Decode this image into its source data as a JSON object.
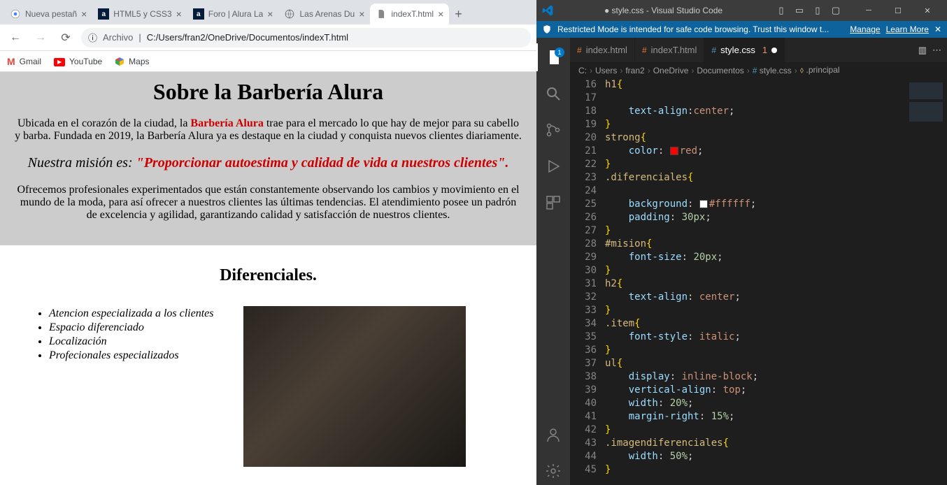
{
  "chrome": {
    "tabs": [
      {
        "title": "Nueva pestañ",
        "favType": "chrome"
      },
      {
        "title": "HTML5 y CSS3",
        "favType": "alura"
      },
      {
        "title": "Foro | Alura La",
        "favType": "alura"
      },
      {
        "title": "Las Arenas Du",
        "favType": "globe"
      },
      {
        "title": "indexT.html",
        "favType": "file",
        "active": true
      }
    ],
    "url_proto": "Archivo",
    "url_path": "C:/Users/fran2/OneDrive/Documentos/indexT.html",
    "bookmarks": [
      {
        "label": "Gmail",
        "icon": "M"
      },
      {
        "label": "YouTube",
        "icon": "▶"
      },
      {
        "label": "Maps",
        "icon": "📍"
      }
    ]
  },
  "page": {
    "h1": "Sobre la Barbería Alura",
    "p1_a": "Ubicada en el corazón de la ciudad, la ",
    "p1_strong": "Barbería Alura",
    "p1_b": " trae para el mercado lo que hay de mejor para su cabello y barba. Fundada en 2019, la Barbería Alura ya es destaque en la ciudad y conquista nuevos clientes diariamente.",
    "mision_a": "Nuestra misión es: ",
    "mision_strong": "\"Proporcionar autoestima y calidad de vida a nuestros clientes\".",
    "p2": "Ofrecemos profesionales experimentados que están constantemente observando los cambios y movimiento en el mundo de la moda, para así ofrecer a nuestros clientes las últimas tendencias. El atendimiento posee un padrón de excelencia y agilidad, garantizando calidad y satisfacción de nuestros clientes.",
    "h2": "Diferenciales.",
    "items": [
      "Atencion especializada a los clientes",
      "Espacio diferenciado",
      "Localización",
      "Profecionales especializados"
    ]
  },
  "vscode": {
    "title": "● style.css - Visual Studio Code",
    "banner_icon_label": "shield",
    "banner_msg": "Restricted Mode is intended for safe code browsing. Trust this window t...",
    "banner_manage": "Manage",
    "banner_learn": "Learn More",
    "editor_tabs": [
      {
        "label": "index.html",
        "icon": "html"
      },
      {
        "label": "indexT.html",
        "icon": "html"
      },
      {
        "label": "style.css",
        "icon": "css",
        "active": true,
        "modified": true,
        "errors": "1"
      }
    ],
    "breadcrumb": [
      "C:",
      "Users",
      "fran2",
      "OneDrive",
      "Documentos",
      "style.css",
      ".principal"
    ],
    "code_start": 16,
    "code_lines": [
      {
        "n": 16,
        "t": [
          [
            "sel",
            "h1"
          ],
          [
            "brace",
            "{"
          ]
        ]
      },
      {
        "n": 17,
        "t": []
      },
      {
        "n": 18,
        "t": [
          [
            "ind",
            "    "
          ],
          [
            "prop",
            "text-align"
          ],
          [
            "punc",
            ":"
          ],
          [
            "val",
            "center"
          ],
          [
            "punc",
            ";"
          ]
        ]
      },
      {
        "n": 19,
        "t": [
          [
            "brace",
            "}"
          ]
        ]
      },
      {
        "n": 20,
        "t": [
          [
            "sel",
            "strong"
          ],
          [
            "brace",
            "{"
          ]
        ]
      },
      {
        "n": 21,
        "t": [
          [
            "ind",
            "    "
          ],
          [
            "prop",
            "color"
          ],
          [
            "punc",
            ": "
          ],
          [
            "color",
            "#ff0000"
          ],
          [
            "val",
            "red"
          ],
          [
            "punc",
            ";"
          ]
        ]
      },
      {
        "n": 22,
        "t": [
          [
            "brace",
            "}"
          ]
        ]
      },
      {
        "n": 23,
        "t": [
          [
            "sel",
            ".diferenciales"
          ],
          [
            "brace",
            "{"
          ]
        ]
      },
      {
        "n": 24,
        "t": []
      },
      {
        "n": 25,
        "t": [
          [
            "ind",
            "    "
          ],
          [
            "prop",
            "background"
          ],
          [
            "punc",
            ": "
          ],
          [
            "color",
            "#ffffff"
          ],
          [
            "val",
            "#ffffff"
          ],
          [
            "punc",
            ";"
          ]
        ]
      },
      {
        "n": 26,
        "t": [
          [
            "ind",
            "    "
          ],
          [
            "prop",
            "padding"
          ],
          [
            "punc",
            ": "
          ],
          [
            "num",
            "30px"
          ],
          [
            "punc",
            ";"
          ]
        ]
      },
      {
        "n": 27,
        "t": [
          [
            "brace",
            "}"
          ]
        ]
      },
      {
        "n": 28,
        "t": [
          [
            "sel",
            "#mision"
          ],
          [
            "brace",
            "{"
          ]
        ]
      },
      {
        "n": 29,
        "t": [
          [
            "ind",
            "    "
          ],
          [
            "prop",
            "font-size"
          ],
          [
            "punc",
            ": "
          ],
          [
            "num",
            "20px"
          ],
          [
            "punc",
            ";"
          ]
        ]
      },
      {
        "n": 30,
        "t": [
          [
            "brace",
            "}"
          ]
        ]
      },
      {
        "n": 31,
        "t": [
          [
            "sel",
            "h2"
          ],
          [
            "brace",
            "{"
          ]
        ]
      },
      {
        "n": 32,
        "t": [
          [
            "ind",
            "    "
          ],
          [
            "prop",
            "text-align"
          ],
          [
            "punc",
            ": "
          ],
          [
            "val",
            "center"
          ],
          [
            "punc",
            ";"
          ]
        ]
      },
      {
        "n": 33,
        "t": [
          [
            "brace",
            "}"
          ]
        ]
      },
      {
        "n": 34,
        "t": [
          [
            "sel",
            ".item"
          ],
          [
            "brace",
            "{"
          ]
        ]
      },
      {
        "n": 35,
        "t": [
          [
            "ind",
            "    "
          ],
          [
            "prop",
            "font-style"
          ],
          [
            "punc",
            ": "
          ],
          [
            "val",
            "italic"
          ],
          [
            "punc",
            ";"
          ]
        ]
      },
      {
        "n": 36,
        "t": [
          [
            "brace",
            "}"
          ]
        ]
      },
      {
        "n": 37,
        "t": [
          [
            "sel",
            "ul"
          ],
          [
            "brace",
            "{"
          ]
        ]
      },
      {
        "n": 38,
        "t": [
          [
            "ind",
            "    "
          ],
          [
            "prop",
            "display"
          ],
          [
            "punc",
            ": "
          ],
          [
            "val",
            "inline-block"
          ],
          [
            "punc",
            ";"
          ]
        ]
      },
      {
        "n": 39,
        "t": [
          [
            "ind",
            "    "
          ],
          [
            "prop",
            "vertical-align"
          ],
          [
            "punc",
            ": "
          ],
          [
            "val",
            "top"
          ],
          [
            "punc",
            ";"
          ]
        ]
      },
      {
        "n": 40,
        "t": [
          [
            "ind",
            "    "
          ],
          [
            "prop",
            "width"
          ],
          [
            "punc",
            ": "
          ],
          [
            "num",
            "20%"
          ],
          [
            "punc",
            ";"
          ]
        ]
      },
      {
        "n": 41,
        "t": [
          [
            "ind",
            "    "
          ],
          [
            "prop",
            "margin-right"
          ],
          [
            "punc",
            ": "
          ],
          [
            "num",
            "15%"
          ],
          [
            "punc",
            ";"
          ]
        ]
      },
      {
        "n": 42,
        "t": [
          [
            "brace",
            "}"
          ]
        ]
      },
      {
        "n": 43,
        "t": [
          [
            "sel",
            ".imagendiferenciales"
          ],
          [
            "brace",
            "{"
          ]
        ]
      },
      {
        "n": 44,
        "t": [
          [
            "ind",
            "    "
          ],
          [
            "prop",
            "width"
          ],
          [
            "punc",
            ": "
          ],
          [
            "num",
            "50%"
          ],
          [
            "punc",
            ";"
          ]
        ]
      },
      {
        "n": 45,
        "t": [
          [
            "brace",
            "}"
          ]
        ]
      }
    ]
  }
}
